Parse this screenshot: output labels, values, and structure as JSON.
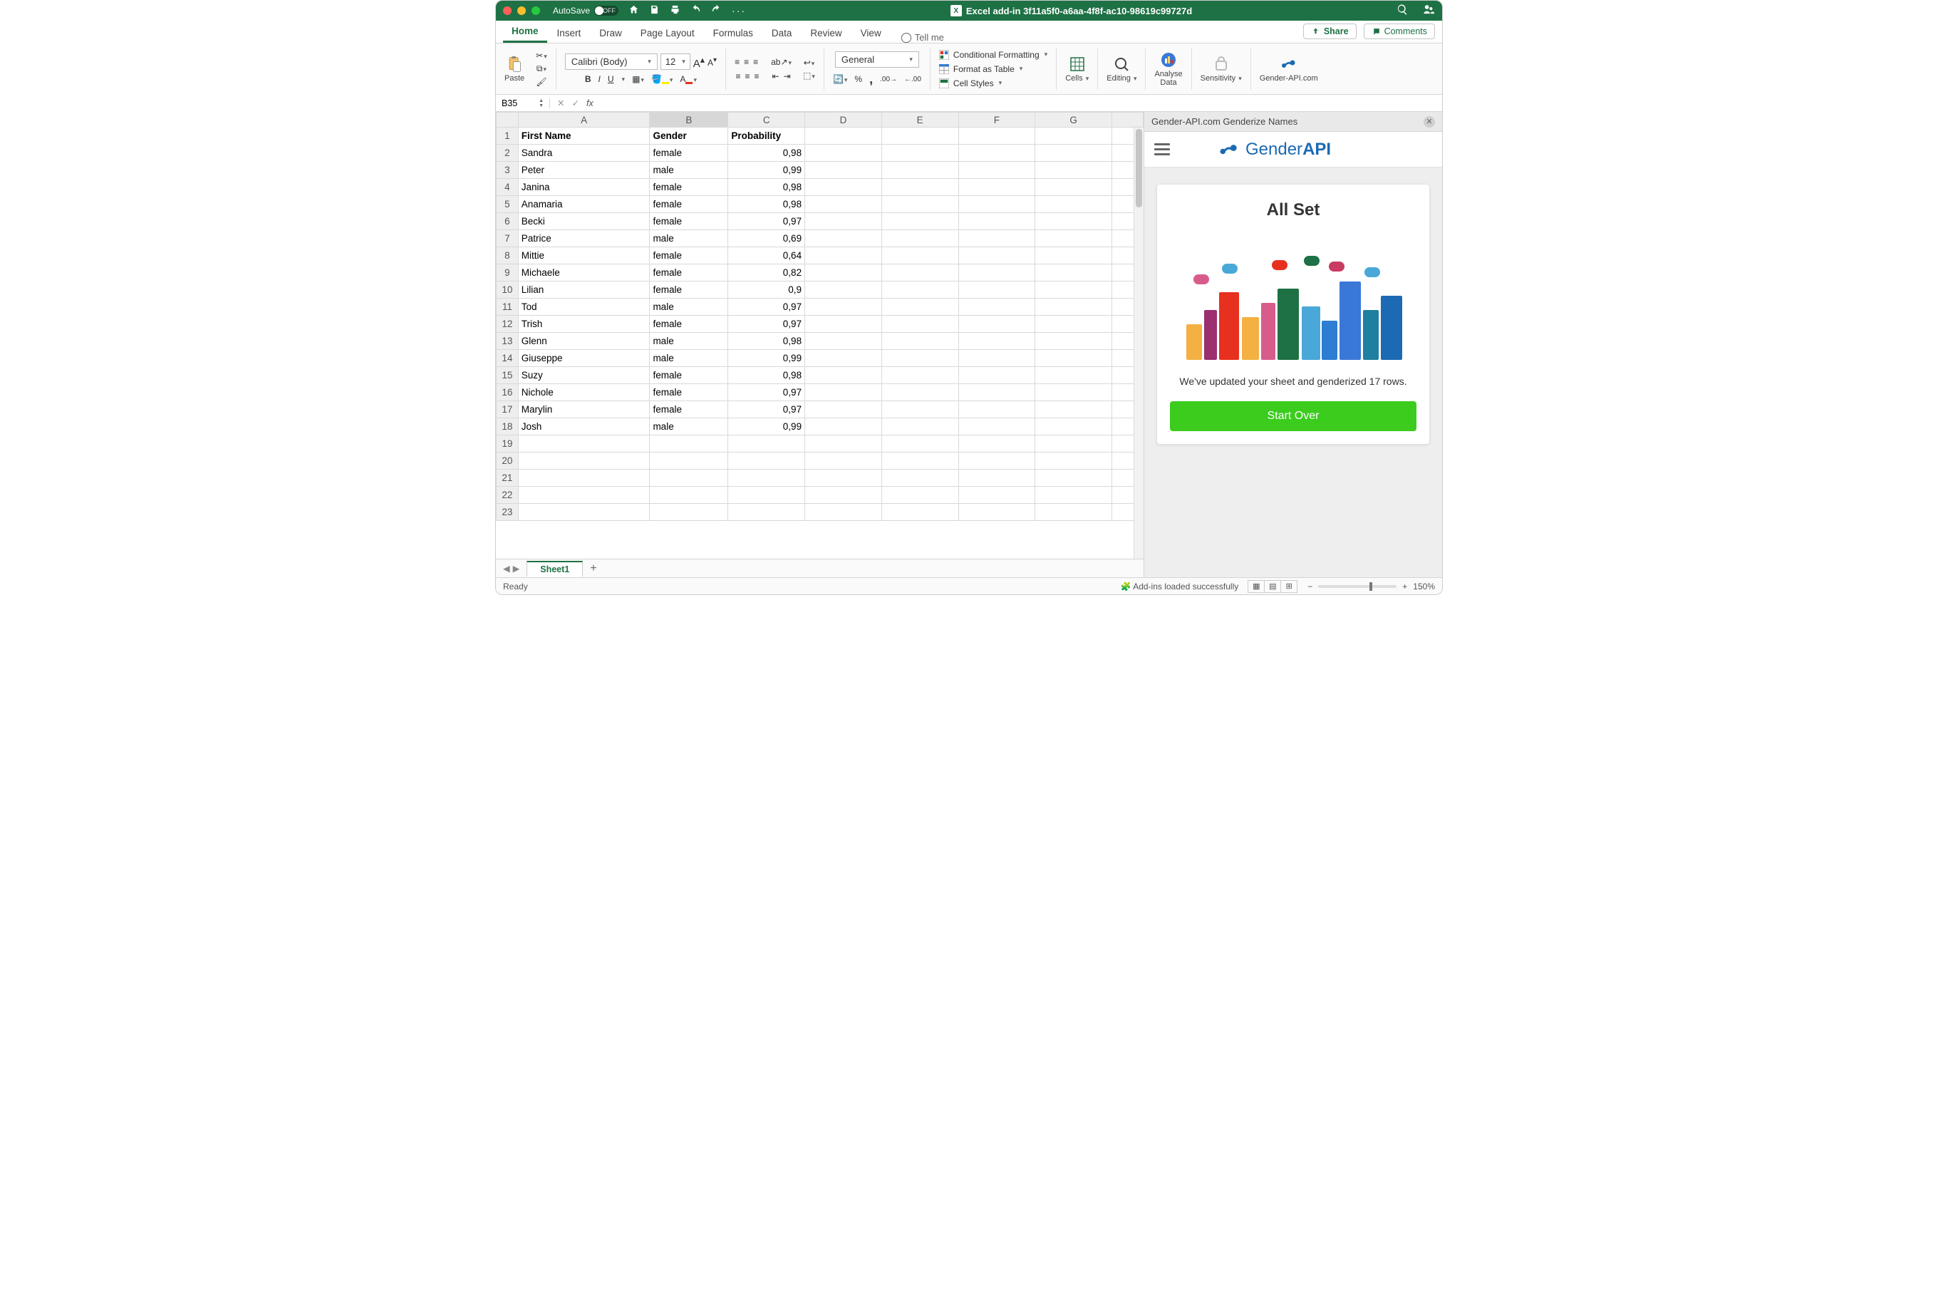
{
  "titlebar": {
    "autosave_label": "AutoSave",
    "autosave_state": "OFF",
    "document_title": "Excel add-in 3f11a5f0-a6aa-4f8f-ac10-98619c99727d"
  },
  "ribbon_tabs": [
    "Home",
    "Insert",
    "Draw",
    "Page Layout",
    "Formulas",
    "Data",
    "Review",
    "View"
  ],
  "tellme_label": "Tell me",
  "share_label": "Share",
  "comments_label": "Comments",
  "ribbon": {
    "paste": "Paste",
    "font_name": "Calibri (Body)",
    "font_size": "12",
    "number_format": "General",
    "conditional": "Conditional Formatting",
    "format_table": "Format as Table",
    "cell_styles": "Cell Styles",
    "cells": "Cells",
    "editing": "Editing",
    "analyse1": "Analyse",
    "analyse2": "Data",
    "sensitivity": "Sensitivity",
    "genderapi": "Gender-API.com"
  },
  "name_box": "B35",
  "columns": [
    "A",
    "B",
    "C",
    "D",
    "E",
    "F",
    "G"
  ],
  "header_row": {
    "A": "First Name",
    "B": "Gender",
    "C": "Probability"
  },
  "rows": [
    {
      "n": "2",
      "A": "Sandra",
      "B": "female",
      "C": "0,98"
    },
    {
      "n": "3",
      "A": "Peter",
      "B": "male",
      "C": "0,99"
    },
    {
      "n": "4",
      "A": "Janina",
      "B": "female",
      "C": "0,98"
    },
    {
      "n": "5",
      "A": "Anamaria",
      "B": "female",
      "C": "0,98"
    },
    {
      "n": "6",
      "A": "Becki",
      "B": "female",
      "C": "0,97"
    },
    {
      "n": "7",
      "A": "Patrice",
      "B": "male",
      "C": "0,69"
    },
    {
      "n": "8",
      "A": "Mittie",
      "B": "female",
      "C": "0,64"
    },
    {
      "n": "9",
      "A": "Michaele",
      "B": "female",
      "C": "0,82"
    },
    {
      "n": "10",
      "A": "Lilian",
      "B": "female",
      "C": "0,9"
    },
    {
      "n": "11",
      "A": "Tod",
      "B": "male",
      "C": "0,97"
    },
    {
      "n": "12",
      "A": "Trish",
      "B": "female",
      "C": "0,97"
    },
    {
      "n": "13",
      "A": "Glenn",
      "B": "male",
      "C": "0,98"
    },
    {
      "n": "14",
      "A": "Giuseppe",
      "B": "male",
      "C": "0,99"
    },
    {
      "n": "15",
      "A": "Suzy",
      "B": "female",
      "C": "0,98"
    },
    {
      "n": "16",
      "A": "Nichole",
      "B": "female",
      "C": "0,97"
    },
    {
      "n": "17",
      "A": "Marylin",
      "B": "female",
      "C": "0,97"
    },
    {
      "n": "18",
      "A": "Josh",
      "B": "male",
      "C": "0,99"
    }
  ],
  "empty_rows": [
    "19",
    "20",
    "21",
    "22",
    "23"
  ],
  "sheet_name": "Sheet1",
  "side": {
    "header": "Gender-API.com Genderize Names",
    "brand1": "Gender",
    "brand2": "API",
    "card_title": "All Set",
    "card_msg": "We've updated your sheet and genderized 17 rows.",
    "button": "Start Over"
  },
  "status": {
    "ready": "Ready",
    "addins": "Add-ins loaded successfully",
    "zoom": "150%"
  }
}
